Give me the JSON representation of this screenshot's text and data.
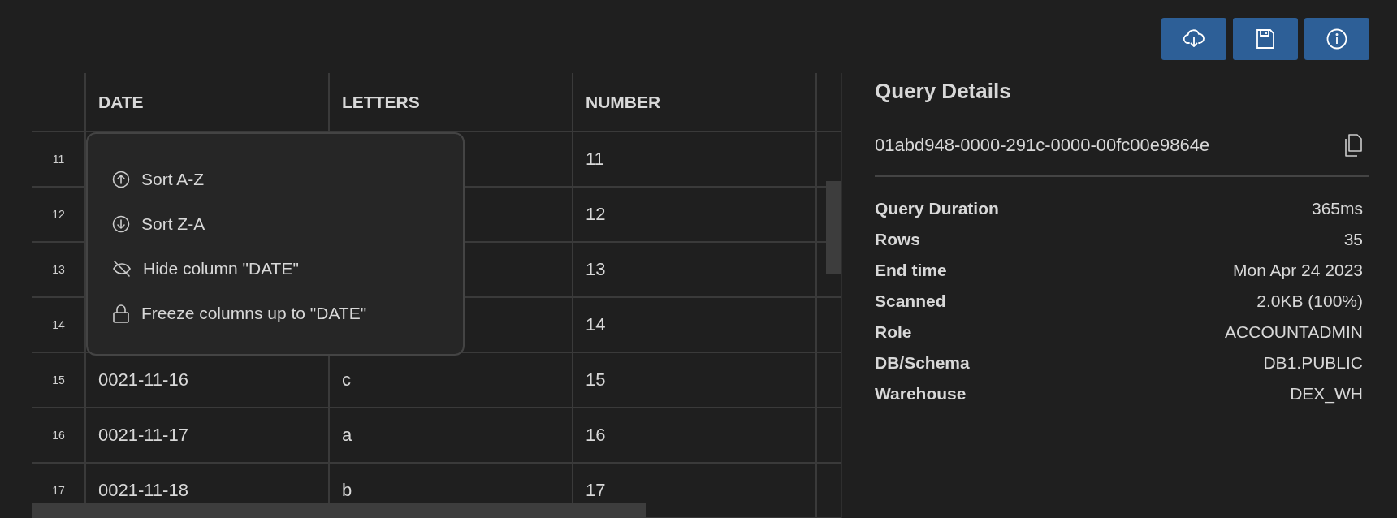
{
  "toolbar": [
    {
      "kind": "download"
    },
    {
      "kind": "save"
    },
    {
      "kind": "info"
    }
  ],
  "table": {
    "columns": [
      "DATE",
      "LETTERS",
      "NUMBER"
    ],
    "rows": [
      {
        "index": "11",
        "number": "11"
      },
      {
        "index": "12",
        "number": "12"
      },
      {
        "index": "13",
        "number": "13"
      },
      {
        "index": "14",
        "number": "14"
      },
      {
        "index": "15",
        "date": "0021-11-16",
        "letters": "c",
        "number": "15"
      },
      {
        "index": "16",
        "date": "0021-11-17",
        "letters": "a",
        "number": "16"
      },
      {
        "index": "17",
        "date": "0021-11-18",
        "letters": "b",
        "number": "17"
      }
    ]
  },
  "column_menu": {
    "items": [
      {
        "kind": "sort-asc",
        "label": "Sort A-Z"
      },
      {
        "kind": "sort-desc",
        "label": "Sort Z-A"
      },
      {
        "kind": "hide",
        "label": "Hide column \"DATE\""
      },
      {
        "kind": "freeze",
        "label": "Freeze columns up to \"DATE\""
      }
    ]
  },
  "query_details": {
    "title": "Query Details",
    "query_id": "01abd948-0000-291c-0000-00fc00e9864e",
    "fields": [
      {
        "label": "Query Duration",
        "value": "365ms"
      },
      {
        "label": "Rows",
        "value": "35"
      },
      {
        "label": "End time",
        "value": "Mon Apr 24 2023"
      },
      {
        "label": "Scanned",
        "value": "2.0KB (100%)"
      },
      {
        "label": "Role",
        "value": "ACCOUNTADMIN"
      },
      {
        "label": "DB/Schema",
        "value": "DB1.PUBLIC"
      },
      {
        "label": "Warehouse",
        "value": "DEX_WH"
      }
    ]
  }
}
